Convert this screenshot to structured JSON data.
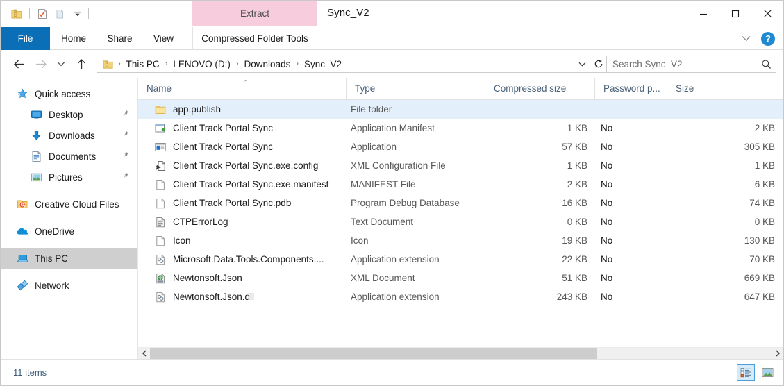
{
  "window": {
    "title": "Sync_V2",
    "minimize_label": "Minimize",
    "maximize_label": "Maximize",
    "close_label": "Close"
  },
  "quick_access_toolbar": {
    "items": [
      {
        "name": "zip-folder-icon",
        "label": "Extract all"
      },
      {
        "name": "properties-icon",
        "label": "Properties"
      },
      {
        "name": "new-folder-icon",
        "label": "New folder"
      },
      {
        "name": "customize-chevron-icon",
        "label": "Customize Quick Access Toolbar"
      }
    ]
  },
  "contextual_tab": {
    "group_label": "Extract",
    "tab_label": "Compressed Folder Tools"
  },
  "ribbon": {
    "tabs": [
      {
        "label": "File",
        "selected": true
      },
      {
        "label": "Home",
        "selected": false
      },
      {
        "label": "Share",
        "selected": false
      },
      {
        "label": "View",
        "selected": false
      }
    ],
    "collapse_label": "Minimize the Ribbon",
    "help_label": "?"
  },
  "address_bar": {
    "back_label": "Back",
    "forward_label": "Forward",
    "recent_label": "Recent locations",
    "up_label": "Up one level",
    "breadcrumbs": [
      "This PC",
      "LENOVO (D:)",
      "Downloads",
      "Sync_V2"
    ],
    "separator": "›",
    "dropdown_label": "Previous Locations",
    "refresh_label": "Refresh"
  },
  "search": {
    "placeholder": "Search Sync_V2",
    "value": "",
    "icon_label": "Search"
  },
  "sidebar": {
    "items": [
      {
        "label": "Quick access",
        "icon": "star-icon",
        "level": 0,
        "pinned": false,
        "selected": false
      },
      {
        "label": "Desktop",
        "icon": "desktop-icon",
        "level": 1,
        "pinned": true,
        "selected": false
      },
      {
        "label": "Downloads",
        "icon": "download-icon",
        "level": 1,
        "pinned": true,
        "selected": false
      },
      {
        "label": "Documents",
        "icon": "documents-icon",
        "level": 1,
        "pinned": true,
        "selected": false
      },
      {
        "label": "Pictures",
        "icon": "pictures-icon",
        "level": 1,
        "pinned": true,
        "selected": false
      },
      {
        "label": "Creative Cloud Files",
        "icon": "creative-cloud-icon",
        "level": 0,
        "pinned": false,
        "selected": false
      },
      {
        "label": "OneDrive",
        "icon": "onedrive-icon",
        "level": 0,
        "pinned": false,
        "selected": false
      },
      {
        "label": "This PC",
        "icon": "this-pc-icon",
        "level": 0,
        "pinned": false,
        "selected": true
      },
      {
        "label": "Network",
        "icon": "network-icon",
        "level": 0,
        "pinned": false,
        "selected": false
      }
    ],
    "pin_glyph": "📌"
  },
  "file_list": {
    "columns": [
      {
        "key": "name",
        "label": "Name",
        "sorted": "asc"
      },
      {
        "key": "type",
        "label": "Type"
      },
      {
        "key": "csize",
        "label": "Compressed size"
      },
      {
        "key": "pwd",
        "label": "Password p..."
      },
      {
        "key": "size",
        "label": "Size"
      }
    ],
    "sort_caret": "⌃",
    "rows": [
      {
        "name": "app.publish",
        "type": "File folder",
        "csize": "",
        "pwd": "",
        "size": "",
        "icon": "folder-icon",
        "selected": true
      },
      {
        "name": "Client Track Portal Sync",
        "type": "Application Manifest",
        "csize": "1 KB",
        "pwd": "No",
        "size": "2 KB",
        "icon": "app-manifest-icon",
        "selected": false
      },
      {
        "name": "Client Track Portal Sync",
        "type": "Application",
        "csize": "57 KB",
        "pwd": "No",
        "size": "305 KB",
        "icon": "application-icon",
        "selected": false
      },
      {
        "name": "Client Track Portal Sync.exe.config",
        "type": "XML Configuration File",
        "csize": "1 KB",
        "pwd": "No",
        "size": "1 KB",
        "icon": "config-file-icon",
        "selected": false
      },
      {
        "name": "Client Track Portal Sync.exe.manifest",
        "type": "MANIFEST File",
        "csize": "2 KB",
        "pwd": "No",
        "size": "6 KB",
        "icon": "blank-file-icon",
        "selected": false
      },
      {
        "name": "Client Track Portal Sync.pdb",
        "type": "Program Debug Database",
        "csize": "16 KB",
        "pwd": "No",
        "size": "74 KB",
        "icon": "blank-file-icon",
        "selected": false
      },
      {
        "name": "CTPErrorLog",
        "type": "Text Document",
        "csize": "0 KB",
        "pwd": "No",
        "size": "0 KB",
        "icon": "text-document-icon",
        "selected": false
      },
      {
        "name": "Icon",
        "type": "Icon",
        "csize": "19 KB",
        "pwd": "No",
        "size": "130 KB",
        "icon": "blank-file-icon",
        "selected": false
      },
      {
        "name": "Microsoft.Data.Tools.Components....",
        "type": "Application extension",
        "csize": "22 KB",
        "pwd": "No",
        "size": "70 KB",
        "icon": "dll-icon",
        "selected": false
      },
      {
        "name": "Newtonsoft.Json",
        "type": "XML Document",
        "csize": "51 KB",
        "pwd": "No",
        "size": "669 KB",
        "icon": "xml-document-icon",
        "selected": false
      },
      {
        "name": "Newtonsoft.Json.dll",
        "type": "Application extension",
        "csize": "243 KB",
        "pwd": "No",
        "size": "647 KB",
        "icon": "dll-icon",
        "selected": false
      }
    ]
  },
  "horizontal_scrollbar": {
    "left_arrow": "‹",
    "right_arrow": "›"
  },
  "status_bar": {
    "item_count": "11 items",
    "details_view_label": "Details view",
    "large_icons_view_label": "Large icons view",
    "active_view": "details"
  },
  "colors": {
    "file_tab_blue": "#0b6fb8",
    "contextual_pink": "#f7ccdc",
    "selection_blue": "#e3f0fb",
    "sidebar_selected_gray": "#cfcfcf",
    "column_header_text": "#4a6178",
    "status_text": "#3a5a78",
    "help_blue": "#1f8ad2"
  }
}
